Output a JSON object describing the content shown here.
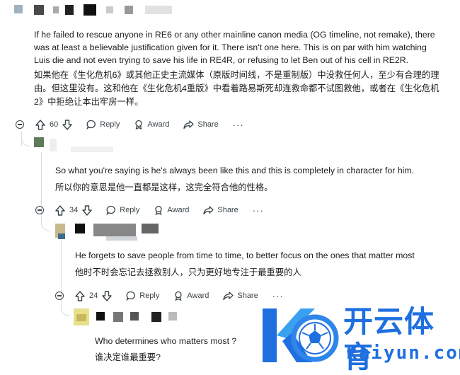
{
  "comments": [
    {
      "text_en": "If he failed to rescue anyone in RE6 or any other mainline canon media (OG timeline, not remake), there was at least a believable justification given for it. There isn't one here. This is on par with him watching Luis die and not even trying to save his life in RE4R, or refusing to let Ben out of his cell in RE2R.",
      "text_zh": "如果他在《生化危机6》或其他正史主流媒体（原版时间线，不是重制版）中没救任何人，至少有合理的理由。但这里没有。这和他在《生化危机4重版》中看着路易斯死却连救命都不试图救他，或者在《生化危机2》中拒绝让本出牢房一样。",
      "score": "60",
      "reply_label": "Reply",
      "award_label": "Award",
      "share_label": "Share",
      "more_label": "···"
    },
    {
      "text_en": "So what you're saying is he's always been like this and this is completely in character for him.",
      "text_zh": "所以你的意思是他一直都是这样，这完全符合他的性格。",
      "score": "34",
      "reply_label": "Reply",
      "award_label": "Award",
      "share_label": "Share",
      "more_label": "···"
    },
    {
      "text_en": "He forgets to save people from time to time, to better focus on the ones that matter most",
      "text_zh": "他时不时会忘记去拯救别人，只为更好地专注于最重要的人",
      "score": "24",
      "reply_label": "Reply",
      "award_label": "Award",
      "share_label": "Share",
      "more_label": "···"
    },
    {
      "text_en": "Who determines who matters most ?",
      "text_zh": "谁决定谁最重要?"
    }
  ],
  "watermark": {
    "brand_cn": "开云体育",
    "brand_en": "kaiyun.com",
    "brand_color": "#1f6fe0"
  },
  "icons": [
    "collapse-icon",
    "upvote-icon",
    "downvote-icon",
    "reply-icon",
    "award-icon",
    "share-icon",
    "more-icon"
  ]
}
